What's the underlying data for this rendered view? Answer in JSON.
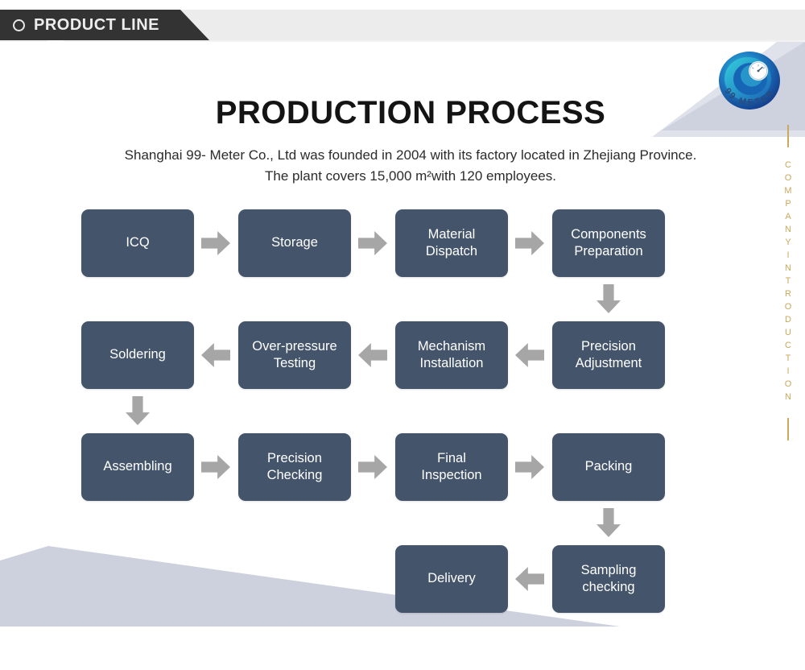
{
  "header": {
    "tab_label": "PRODUCT LINE",
    "bullet_icon": "circle-outline-icon"
  },
  "sidebar": {
    "vertical_label": "COMPANYINTRODUCTION",
    "color": "#c9a95c"
  },
  "logo": {
    "brand": "99 METER",
    "icon": "meter-swirl-logo"
  },
  "title": {
    "heading": "PRODUCTION PROCESS",
    "description": "Shanghai 99- Meter Co., Ltd was founded in 2004 with its factory located in Zhejiang Province. The plant covers 15,000 m²with 120 employees."
  },
  "colors": {
    "node_fill": "#44546a",
    "arrow_fill": "#a6a6a6",
    "banner_dark": "#333333",
    "banner_light": "#ececec",
    "deco_blue_gray": "#ccd1dd"
  },
  "flow": {
    "rows": [
      {
        "direction": "right",
        "nodes": [
          {
            "label": "ICQ"
          },
          {
            "label": "Storage"
          },
          {
            "label": "Material\nDispatch"
          },
          {
            "label": "Components\nPreparation"
          }
        ]
      },
      {
        "direction": "left",
        "nodes": [
          {
            "label": "Soldering"
          },
          {
            "label": "Over-pressure\nTesting"
          },
          {
            "label": "Mechanism\nInstallation"
          },
          {
            "label": "Precision\nAdjustment"
          }
        ]
      },
      {
        "direction": "right",
        "nodes": [
          {
            "label": "Assembling"
          },
          {
            "label": "Precision\nChecking"
          },
          {
            "label": "Final\nInspection"
          },
          {
            "label": "Packing"
          }
        ]
      },
      {
        "direction": "left",
        "nodes": [
          {
            "label": "Delivery"
          },
          {
            "label": "Sampling\nchecking"
          }
        ]
      }
    ],
    "connector_arrows": [
      "right",
      "right",
      "right",
      "down",
      "left",
      "left",
      "left",
      "down",
      "right",
      "right",
      "right",
      "down",
      "left"
    ],
    "sequence": [
      "ICQ",
      "Storage",
      "Material Dispatch",
      "Components Preparation",
      "Precision Adjustment",
      "Mechanism Installation",
      "Over-pressure Testing",
      "Soldering",
      "Assembling",
      "Precision Checking",
      "Final Inspection",
      "Packing",
      "Sampling checking",
      "Delivery"
    ]
  }
}
